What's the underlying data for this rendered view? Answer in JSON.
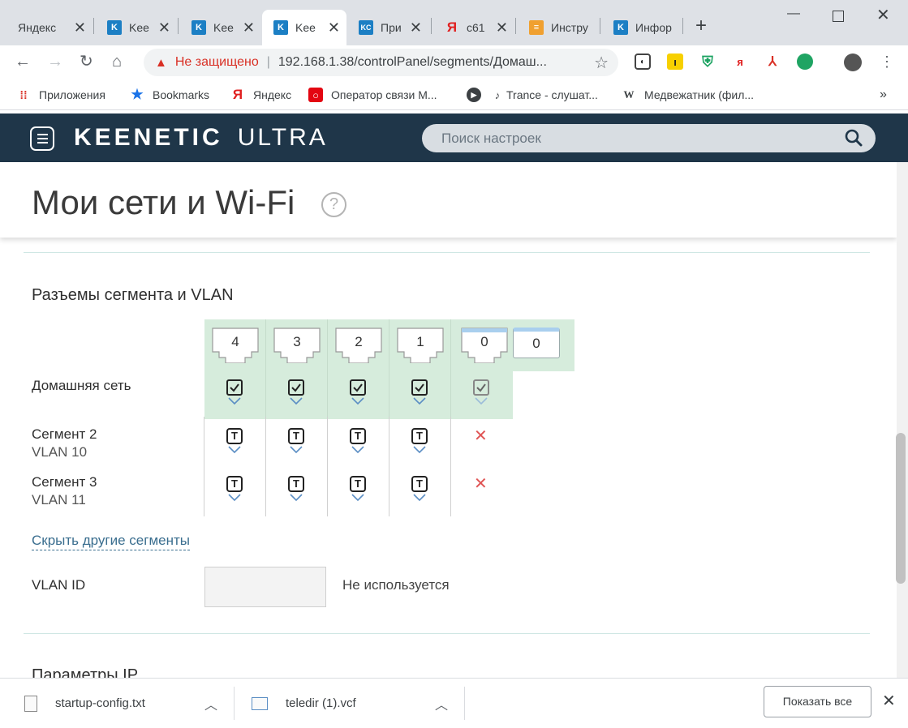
{
  "browser": {
    "tabs": [
      {
        "title": "Яндекс",
        "favicon": "yandex-text"
      },
      {
        "title": "Kee",
        "favicon": "keenetic-icon"
      },
      {
        "title": "Kee",
        "favicon": "keenetic-icon"
      },
      {
        "title": "Kee",
        "favicon": "keenetic-icon"
      },
      {
        "title": "При",
        "favicon": "kc-icon"
      },
      {
        "title": "с61",
        "favicon": "yandex-icon"
      },
      {
        "title": "Инстру",
        "favicon": "instr-icon"
      },
      {
        "title": "Инфор",
        "favicon": "keenetic-icon"
      }
    ],
    "address": {
      "security_text": "Не защищено",
      "url": "192.168.1.38/controlPanel/segments/Домаш..."
    },
    "bookmarks": [
      {
        "label": "Приложения",
        "icon": "apps-grid-icon"
      },
      {
        "label": "Bookmarks",
        "icon": "star-icon"
      },
      {
        "label": "Яндекс",
        "icon": "yandex-icon"
      },
      {
        "label": "Оператор связи М...",
        "icon": "mts-icon"
      },
      {
        "label": "",
        "icon": "play-circle-icon"
      },
      {
        "label": "Trance - слушат...",
        "icon": "guitar-icon"
      },
      {
        "label": "Медвежатник (фил...",
        "icon": "wikipedia-icon"
      }
    ],
    "bookmarks_more": "»"
  },
  "header": {
    "brand_primary": "KEENETIC",
    "brand_secondary": "ULTRA",
    "search_placeholder": "Поиск настроек"
  },
  "page": {
    "title": "Мои сети и Wi-Fi",
    "help_glyph": "?",
    "section_title": "Разъемы сегмента и VLAN",
    "ports": [
      "4",
      "3",
      "2",
      "1",
      "0",
      "0"
    ],
    "rows": [
      {
        "name": "Домашняя сеть",
        "vlan": "",
        "cells": [
          "checked",
          "checked",
          "checked",
          "checked",
          "checked-dim"
        ]
      },
      {
        "name": "Сегмент 2",
        "vlan": "VLAN 10",
        "cells": [
          "tagged",
          "tagged",
          "tagged",
          "tagged",
          "none"
        ]
      },
      {
        "name": "Сегмент 3",
        "vlan": "VLAN 11",
        "cells": [
          "tagged",
          "tagged",
          "tagged",
          "tagged",
          "none"
        ]
      }
    ],
    "tag_glyph": "T",
    "cross_glyph": "✕",
    "hide_segments_link": "Скрыть другие сегменты",
    "vlan_id_label": "VLAN ID",
    "vlan_id_value": "",
    "vlan_status": "Не используется",
    "next_section_title": "Параметры IP"
  },
  "downloads": {
    "items": [
      {
        "name": "startup-config.txt"
      },
      {
        "name": "teledir (1).vcf"
      }
    ],
    "show_all": "Показать все"
  },
  "colors": {
    "header_bg": "#1f3649",
    "segment_green": "#d6ecdc",
    "link": "#3a6e8f",
    "cross": "#e05555",
    "insecure": "#d93025"
  }
}
